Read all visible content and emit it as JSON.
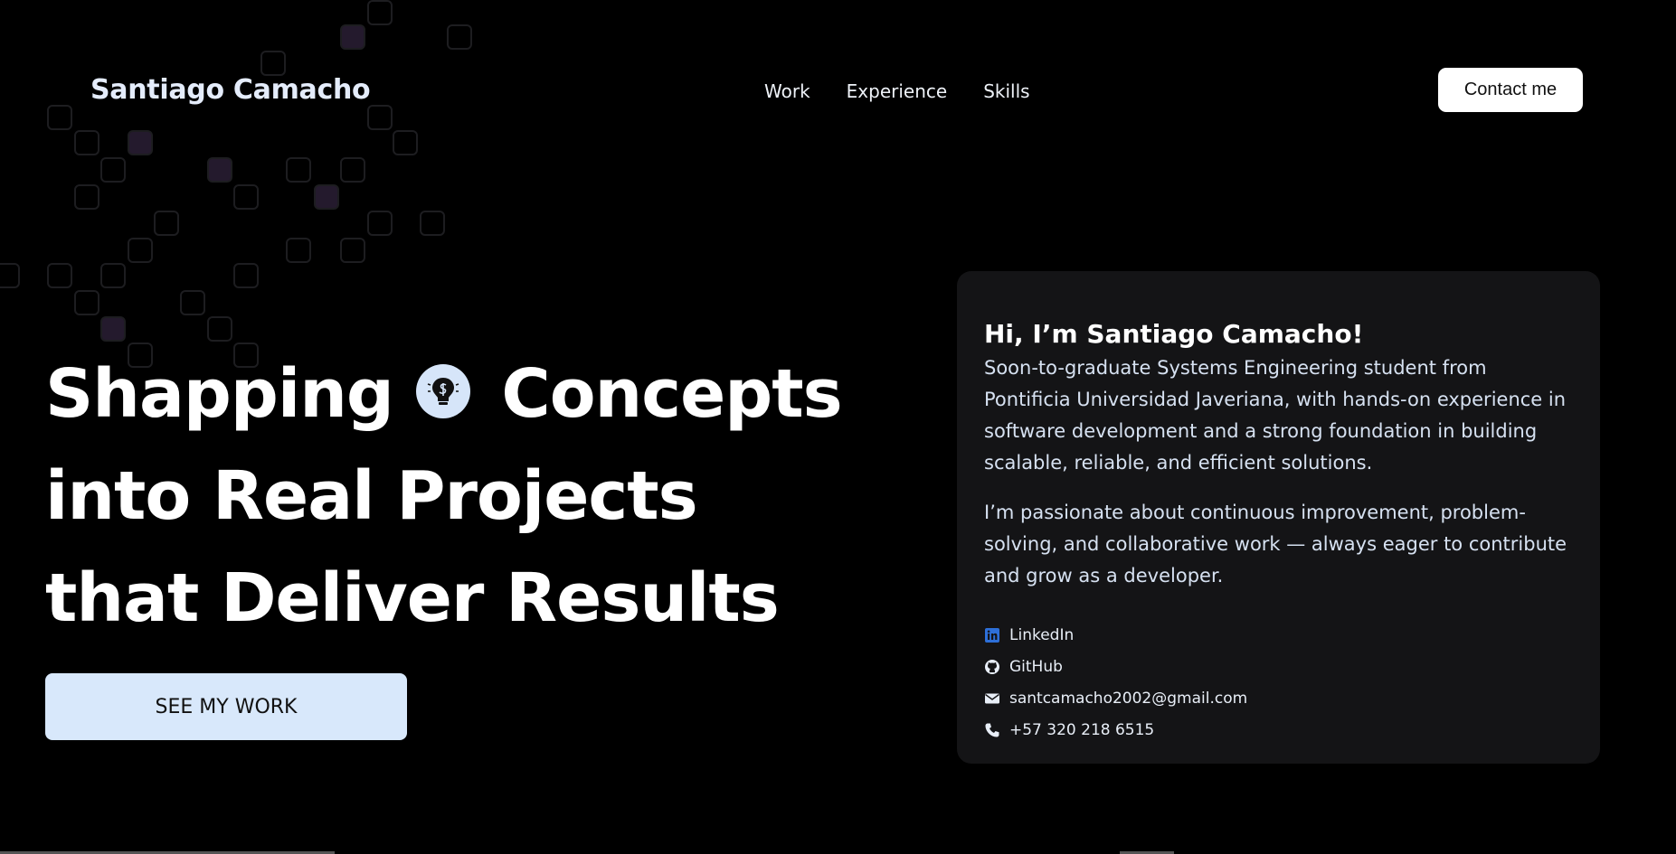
{
  "header": {
    "brand": "Santiago Camacho",
    "nav": [
      "Work",
      "Experience",
      "Skills"
    ],
    "contact_label": "Contact me"
  },
  "hero": {
    "line1a": "Shapping",
    "line1b": "Concepts",
    "line2": "into Real Projects",
    "line3": "that Deliver Results",
    "icon": "lightbulb-icon",
    "cta_label": "SEE MY WORK"
  },
  "about": {
    "title": "Hi, I’m Santiago Camacho!",
    "para1": "Soon-to-graduate Systems Engineering student from Pontificia Universidad Javeriana, with hands-on experience in software development and a strong foundation in building scalable, reliable, and efficient solutions.",
    "para2": "I’m passionate about continuous improvement, problem-solving, and collaborative work — always eager to contribute and grow as a developer.",
    "links": [
      {
        "label": "LinkedIn",
        "icon": "linkedin-icon"
      },
      {
        "label": "GitHub",
        "icon": "github-icon"
      },
      {
        "label": "santcamacho2002@gmail.com",
        "icon": "envelope-icon"
      },
      {
        "label": "+57 320 218 6515",
        "icon": "phone-icon"
      }
    ]
  },
  "colors": {
    "background": "#000000",
    "card": "#141416",
    "accent_light_blue": "#d8e8fb",
    "linkedin_blue": "#2d6fd8",
    "grid_outline": "#1d1d20",
    "grid_fill_purple": "#241a2d"
  }
}
